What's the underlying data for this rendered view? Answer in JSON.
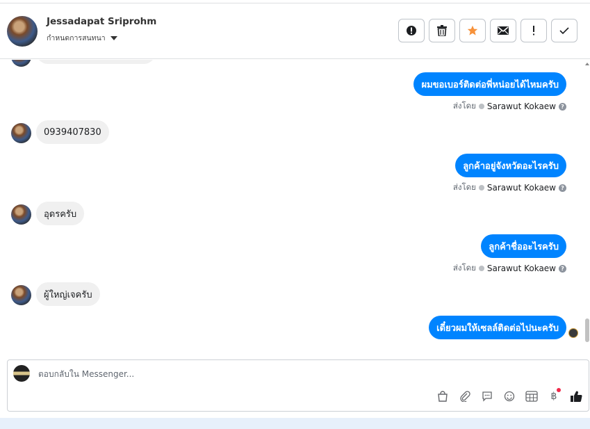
{
  "header": {
    "name": "Jessadapat Sriprohm",
    "status_label": "กำหนดการสนทนา"
  },
  "actions": [
    {
      "name": "spam-button",
      "icon": "alert-circle-icon"
    },
    {
      "name": "delete-button",
      "icon": "trash-icon"
    },
    {
      "name": "star-button",
      "icon": "star-icon",
      "color": "#f7923b"
    },
    {
      "name": "mark-unread-button",
      "icon": "envelope-icon"
    },
    {
      "name": "important-button",
      "icon": "exclamation-icon"
    },
    {
      "name": "done-button",
      "icon": "check-icon"
    }
  ],
  "messages": [
    {
      "dir": "out",
      "text": "ผมขอเบอร์ติดต่อพี่หน่อยได้ไหมครับ",
      "sent_by_label": "ส่งโดย",
      "sender": "Sarawut Kokaew"
    },
    {
      "dir": "in",
      "text": "0939407830"
    },
    {
      "dir": "out",
      "text": "ลูกค้าอยู่จังหวัดอะไรครับ",
      "sent_by_label": "ส่งโดย",
      "sender": "Sarawut Kokaew"
    },
    {
      "dir": "in",
      "text": "อุดรครับ"
    },
    {
      "dir": "out",
      "text": "ลูกค้าชื่ออะไรครับ",
      "sent_by_label": "ส่งโดย",
      "sender": "Sarawut Kokaew"
    },
    {
      "dir": "in",
      "text": "ผู้ใหญ่เจครับ"
    },
    {
      "dir": "out",
      "text": "เดี๋ยวผมให้เซลล์ติดต่อไปนะครับ"
    }
  ],
  "reply": {
    "placeholder": "ตอบกลับใน Messenger..."
  },
  "tools": [
    "shopping-bag-icon",
    "paperclip-icon",
    "saved-reply-icon",
    "emoji-icon",
    "table-icon",
    "baht-icon",
    "like-icon"
  ],
  "colors": {
    "accent": "#0084ff",
    "star": "#f7923b",
    "badge": "#f02849"
  }
}
